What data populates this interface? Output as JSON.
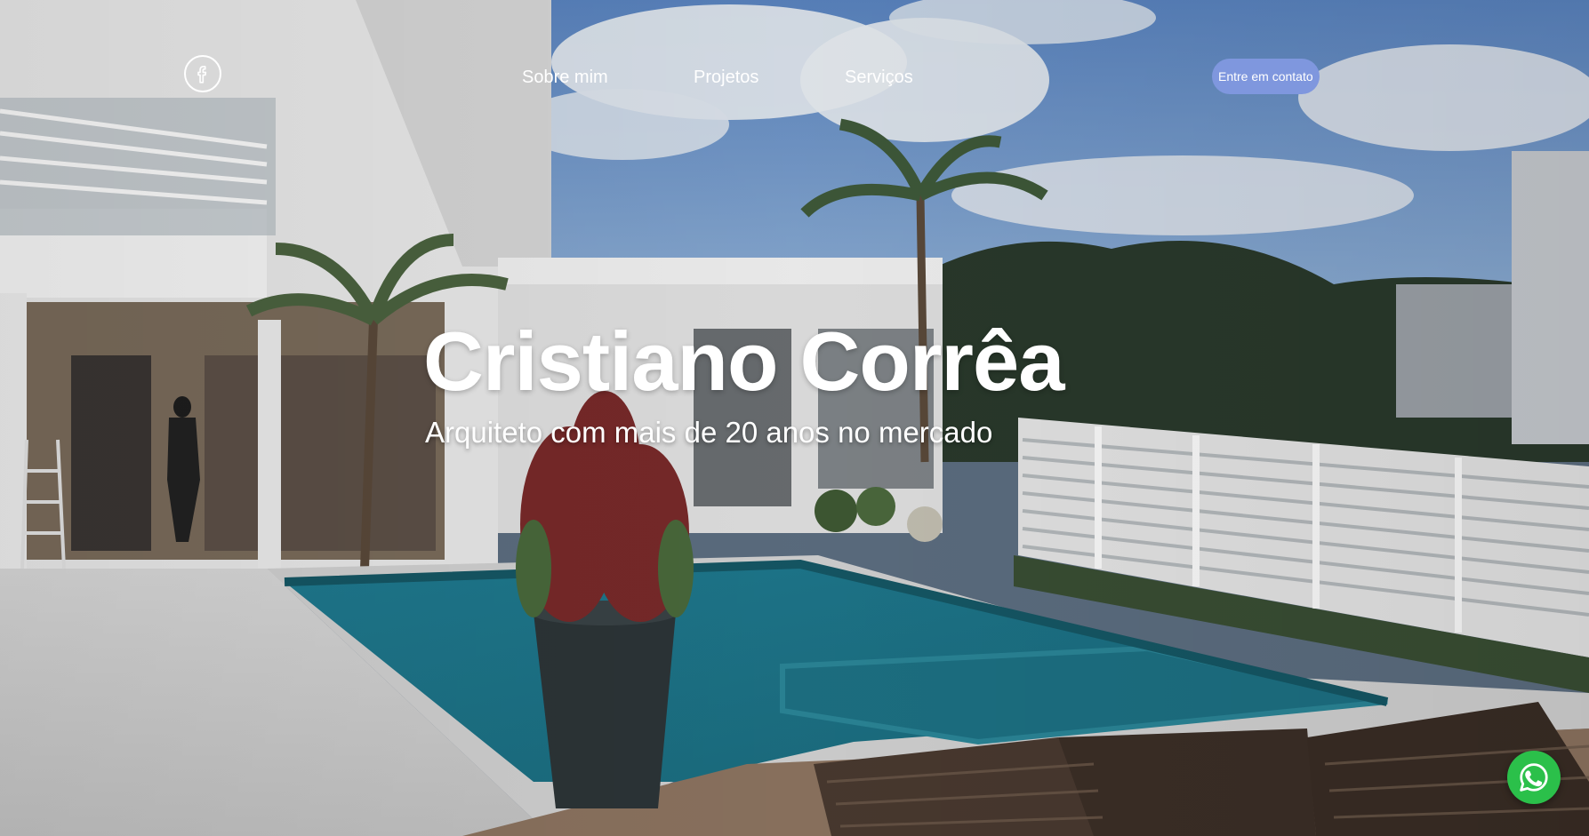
{
  "header": {
    "logo_icon": "facebook-icon",
    "nav": [
      {
        "label": "Sobre mim"
      },
      {
        "label": "Projetos"
      },
      {
        "label": "Serviços"
      }
    ],
    "cta_label": "Entre em contato"
  },
  "hero": {
    "title": "Cristiano Corrêa",
    "subtitle": "Arquiteto com mais de 20 anos no mercado",
    "background_image": "house-with-pool-photo"
  },
  "floating": {
    "icon": "whatsapp-icon"
  },
  "colors": {
    "cta_background": "#7f97de",
    "whatsapp_green": "#2bc04a",
    "text": "#ffffff"
  }
}
